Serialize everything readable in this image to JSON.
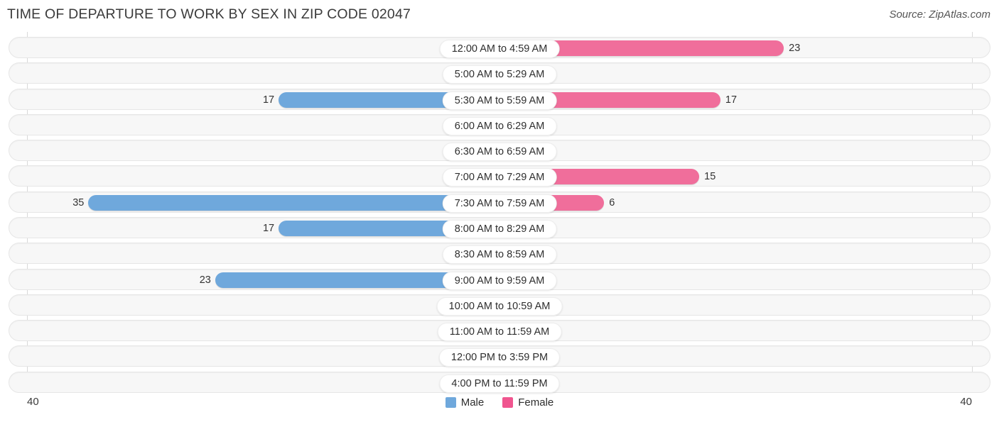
{
  "header": {
    "title": "TIME OF DEPARTURE TO WORK BY SEX IN ZIP CODE 02047",
    "source": "Source: ZipAtlas.com"
  },
  "legend": {
    "male_label": "Male",
    "female_label": "Female",
    "male_color": "#6FA8DC",
    "female_color": "#F0558F"
  },
  "axis": {
    "left_tick": "40",
    "right_tick": "40"
  },
  "colors": {
    "male_bar": "#6FA8DC",
    "male_bar_zero": "#A9C9E9",
    "female_bar": "#F06E9B",
    "female_bar_zero": "#F6A5C2",
    "row_track": "#f7f7f7",
    "row_border": "#e6e6e6",
    "axis_line": "#d8d8d8"
  },
  "chart_data": {
    "type": "bar",
    "title": "TIME OF DEPARTURE TO WORK BY SEX IN ZIP CODE 02047",
    "subtitle": "",
    "orientation": "horizontal-diverging",
    "xlabel": "",
    "ylabel": "",
    "xlim": [
      -40,
      40
    ],
    "axis_max": 40,
    "grid": false,
    "legend_position": "bottom-center",
    "categories": [
      "12:00 AM to 4:59 AM",
      "5:00 AM to 5:29 AM",
      "5:30 AM to 5:59 AM",
      "6:00 AM to 6:29 AM",
      "6:30 AM to 6:59 AM",
      "7:00 AM to 7:29 AM",
      "7:30 AM to 7:59 AM",
      "8:00 AM to 8:29 AM",
      "8:30 AM to 8:59 AM",
      "9:00 AM to 9:59 AM",
      "10:00 AM to 10:59 AM",
      "11:00 AM to 11:59 AM",
      "12:00 PM to 3:59 PM",
      "4:00 PM to 11:59 PM"
    ],
    "series": [
      {
        "name": "Male",
        "color": "#6FA8DC",
        "values": [
          0,
          0,
          17,
          0,
          0,
          0,
          35,
          17,
          0,
          23,
          0,
          0,
          0,
          0
        ]
      },
      {
        "name": "Female",
        "color": "#F0558F",
        "values": [
          23,
          0,
          17,
          0,
          0,
          15,
          6,
          0,
          0,
          0,
          0,
          0,
          0,
          0
        ]
      }
    ]
  }
}
